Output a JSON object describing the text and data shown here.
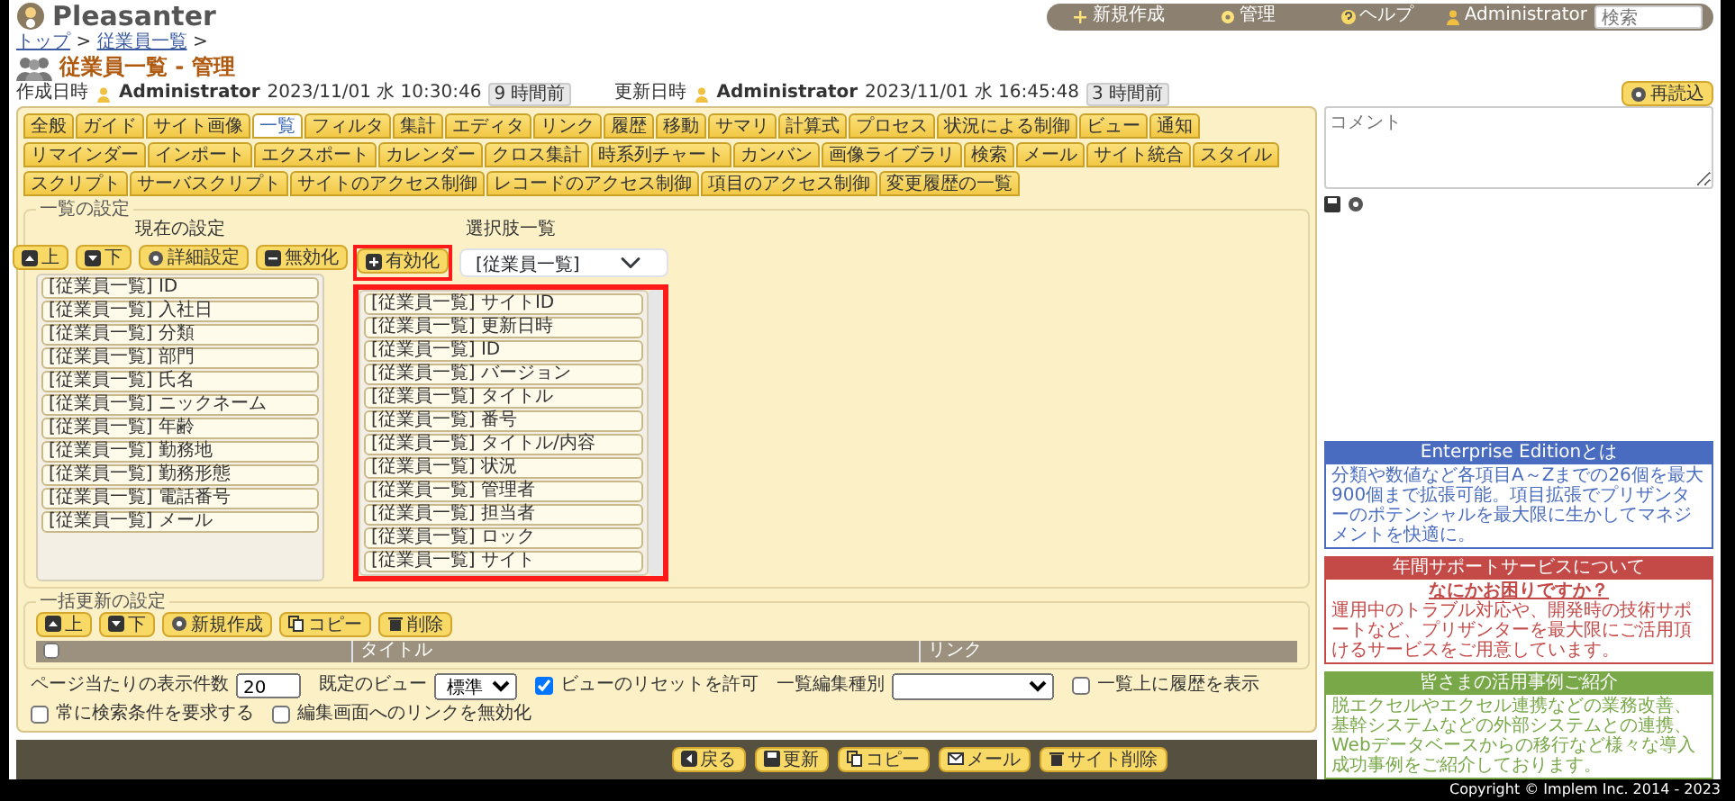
{
  "header": {
    "logo": "Pleasanter",
    "nav": [
      "新規作成",
      "管理",
      "ヘルプ",
      "Administrator"
    ],
    "search_placeholder": "検索"
  },
  "breadcrumb": {
    "items": [
      "トップ",
      "従業員一覧"
    ],
    "separator": ">"
  },
  "title": "従業員一覧 - 管理",
  "record_info": [
    {
      "label": "作成日時",
      "user": "Administrator",
      "datetime": "2023/11/01 水 10:30:46",
      "ago": "9 時間前"
    },
    {
      "label": "更新日時",
      "user": "Administrator",
      "datetime": "2023/11/01 水 16:45:48",
      "ago": "3 時間前"
    }
  ],
  "reload_button": "再読込",
  "tabs": [
    {
      "label": "全般",
      "selected": false
    },
    {
      "label": "ガイド",
      "selected": false
    },
    {
      "label": "サイト画像",
      "selected": false
    },
    {
      "label": "一覧",
      "selected": true
    },
    {
      "label": "フィルタ",
      "selected": false
    },
    {
      "label": "集計",
      "selected": false
    },
    {
      "label": "エディタ",
      "selected": false
    },
    {
      "label": "リンク",
      "selected": false
    },
    {
      "label": "履歴",
      "selected": false
    },
    {
      "label": "移動",
      "selected": false
    },
    {
      "label": "サマリ",
      "selected": false
    },
    {
      "label": "計算式",
      "selected": false
    },
    {
      "label": "プロセス",
      "selected": false
    },
    {
      "label": "状況による制御",
      "selected": false
    },
    {
      "label": "ビュー",
      "selected": false
    },
    {
      "label": "通知",
      "selected": false
    },
    {
      "label": "リマインダー",
      "selected": false
    },
    {
      "label": "インポート",
      "selected": false
    },
    {
      "label": "エクスポート",
      "selected": false
    },
    {
      "label": "カレンダー",
      "selected": false
    },
    {
      "label": "クロス集計",
      "selected": false
    },
    {
      "label": "時系列チャート",
      "selected": false
    },
    {
      "label": "カンバン",
      "selected": false
    },
    {
      "label": "画像ライブラリ",
      "selected": false
    },
    {
      "label": "検索",
      "selected": false
    },
    {
      "label": "メール",
      "selected": false
    },
    {
      "label": "サイト統合",
      "selected": false
    },
    {
      "label": "スタイル",
      "selected": false
    },
    {
      "label": "スクリプト",
      "selected": false
    },
    {
      "label": "サーバスクリプト",
      "selected": false
    },
    {
      "label": "サイトのアクセス制御",
      "selected": false
    },
    {
      "label": "レコードのアクセス制御",
      "selected": false
    },
    {
      "label": "項目のアクセス制御",
      "selected": false
    },
    {
      "label": "変更履歴の一覧",
      "selected": false
    }
  ],
  "list_settings": {
    "legend": "一覧の設定",
    "current": {
      "heading": "現在の設定",
      "buttons": [
        "上",
        "下",
        "詳細設定",
        "無効化"
      ],
      "items": [
        "[従業員一覧] ID",
        "[従業員一覧] 入社日",
        "[従業員一覧] 分類",
        "[従業員一覧] 部門",
        "[従業員一覧] 氏名",
        "[従業員一覧] ニックネーム",
        "[従業員一覧] 年齢",
        "[従業員一覧] 勤務地",
        "[従業員一覧] 勤務形態",
        "[従業員一覧] 電話番号",
        "[従業員一覧] メール"
      ]
    },
    "available": {
      "heading": "選択肢一覧",
      "button": {
        "label": "有効化",
        "highlighted": true
      },
      "select_value": "[従業員一覧]",
      "highlighted": true,
      "items": [
        "[従業員一覧] サイトID",
        "[従業員一覧] 更新日時",
        "[従業員一覧] ID",
        "[従業員一覧] バージョン",
        "[従業員一覧] タイトル",
        "[従業員一覧] 番号",
        "[従業員一覧] タイトル/内容",
        "[従業員一覧] 状況",
        "[従業員一覧] 管理者",
        "[従業員一覧] 担当者",
        "[従業員一覧] ロック",
        "[従業員一覧] サイト"
      ]
    }
  },
  "bulk_settings": {
    "legend": "一括更新の設定",
    "buttons": [
      "上",
      "下",
      "新規作成",
      "コピー",
      "削除"
    ],
    "table": {
      "select_all_checked": false,
      "columns": [
        "タイトル",
        "リンク"
      ]
    }
  },
  "options": [
    {
      "kind": "number",
      "label": "ページ当たりの表示件数",
      "value": "20"
    },
    {
      "kind": "select",
      "label": "既定のビュー",
      "value": "標準"
    },
    {
      "kind": "checkbox",
      "label": "ビューのリセットを許可",
      "checked": true
    },
    {
      "kind": "select",
      "label": "一覧編集種別"
    },
    {
      "kind": "checkbox",
      "label": "一覧上に履歴を表示",
      "checked": false
    },
    {
      "kind": "checkbox",
      "label": "常に検索条件を要求する",
      "checked": false
    },
    {
      "kind": "checkbox",
      "label": "編集画面へのリンクを無効化",
      "checked": false
    }
  ],
  "footer_buttons": [
    "戻る",
    "更新",
    "コピー",
    "メール",
    "サイト削除"
  ],
  "comment": {
    "placeholder": "コメント"
  },
  "ads": [
    {
      "title": "Enterprise Editionとは",
      "color": "#4a6cc0",
      "body": "分類や数値など各項目A～Zまでの26個を最大900個まで拡張可能。項目拡張でプリザンターのポテンシャルを最大限に生かしてマネジメントを快適に。"
    },
    {
      "title": "年間サポートサービスについて",
      "color": "#c44a48",
      "subtitle": "なにかお困りですか？",
      "body": "運用中のトラブル対応や、開発時の技術サポートなど、プリザンターを最大限にご活用頂けるサービスをご用意しています。"
    },
    {
      "title": "皆さまの活用事例ご紹介",
      "color": "#78a848",
      "body": "脱エクセルやエクセル連携などの業務改善、基幹システムなどの外部システムとの連携、Webデータベースからの移行など様々な導入成功事例をご紹介しております。"
    }
  ],
  "copyright": "Copyright © Implem Inc. 2014 - 2023"
}
